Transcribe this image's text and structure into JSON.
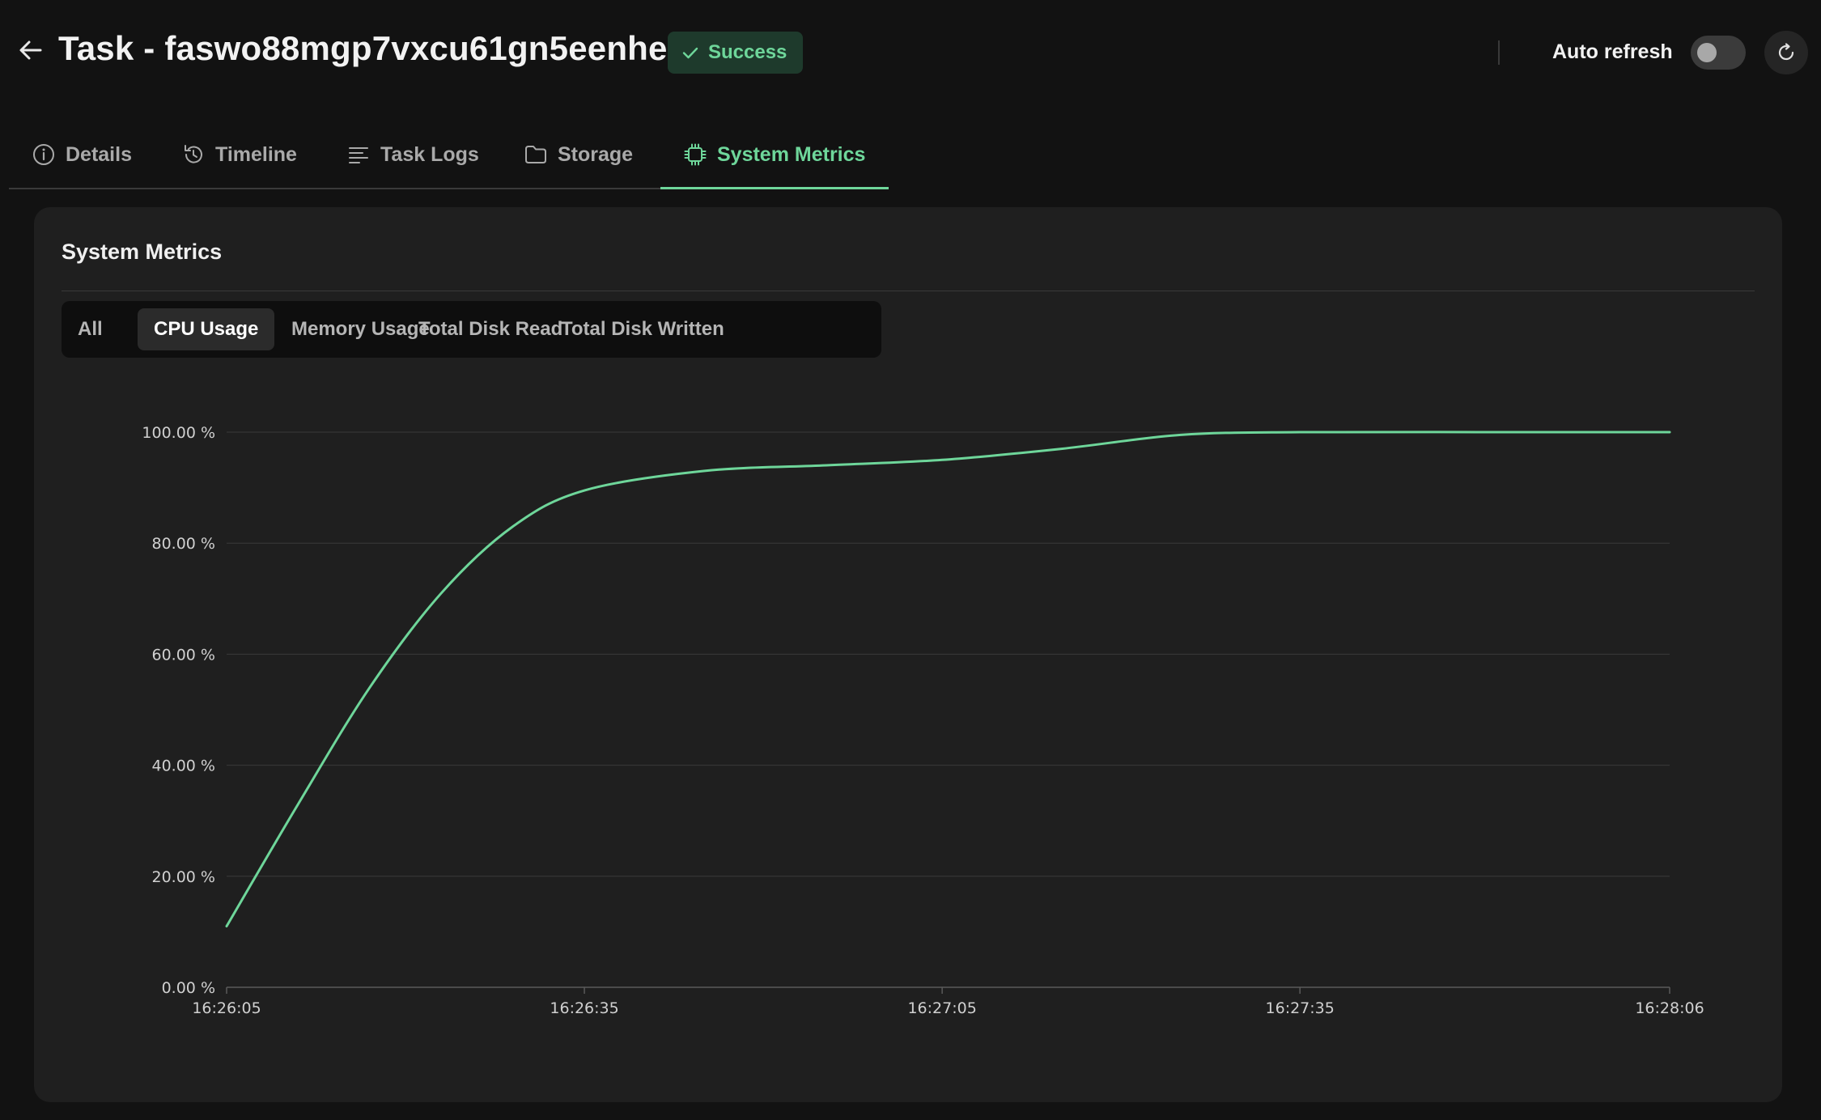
{
  "header": {
    "title": "Task - faswo88mgp7vxcu61gn5eenhe",
    "back_icon": "arrow-left-icon",
    "status": {
      "label": "Success",
      "icon": "check-icon",
      "color": "#6ed69a",
      "bg": "#1e3a2c"
    },
    "auto_refresh": {
      "label": "Auto refresh",
      "enabled": false
    },
    "refresh_icon": "refresh-icon"
  },
  "tabs": [
    {
      "label": "Details",
      "icon": "info-icon",
      "active": false
    },
    {
      "label": "Timeline",
      "icon": "history-icon",
      "active": false
    },
    {
      "label": "Task Logs",
      "icon": "lines-icon",
      "active": false
    },
    {
      "label": "Storage",
      "icon": "folder-icon",
      "active": false
    },
    {
      "label": "System Metrics",
      "icon": "cpu-chip-icon",
      "active": true
    }
  ],
  "panel": {
    "title": "System Metrics",
    "segments": [
      {
        "label": "All",
        "active": false
      },
      {
        "label": "CPU Usage",
        "active": true
      },
      {
        "label": "Memory Usage",
        "active": false
      },
      {
        "label": "Total Disk Read",
        "active": false
      },
      {
        "label": "Total Disk Written",
        "active": false
      }
    ]
  },
  "colors": {
    "accent": "#6ed69a",
    "background": "#121212",
    "panel": "#1f1f1f"
  },
  "chart_data": {
    "type": "line",
    "title": "",
    "xlabel": "",
    "ylabel": "",
    "y_ticks": [
      "0.00 %",
      "20.00 %",
      "40.00 %",
      "60.00 %",
      "80.00 %",
      "100.00 %"
    ],
    "x_ticks": [
      "16:26:05",
      "16:26:35",
      "16:27:05",
      "16:27:35",
      "16:28:06"
    ],
    "ylim": [
      0,
      100
    ],
    "xlim": [
      "16:26:05",
      "16:28:06"
    ],
    "grid": true,
    "legend": "none",
    "series": [
      {
        "color": "#6ed69a",
        "points": [
          {
            "x": "16:26:05",
            "y": 11
          },
          {
            "x": "16:26:11",
            "y": 33
          },
          {
            "x": "16:26:17",
            "y": 54
          },
          {
            "x": "16:26:23",
            "y": 71
          },
          {
            "x": "16:26:29",
            "y": 83
          },
          {
            "x": "16:26:35",
            "y": 89.5
          },
          {
            "x": "16:26:45",
            "y": 93
          },
          {
            "x": "16:26:55",
            "y": 94
          },
          {
            "x": "16:27:05",
            "y": 95
          },
          {
            "x": "16:27:15",
            "y": 97
          },
          {
            "x": "16:27:25",
            "y": 99.5
          },
          {
            "x": "16:27:35",
            "y": 100
          },
          {
            "x": "16:27:50",
            "y": 100
          },
          {
            "x": "16:28:06",
            "y": 100
          }
        ]
      }
    ]
  }
}
